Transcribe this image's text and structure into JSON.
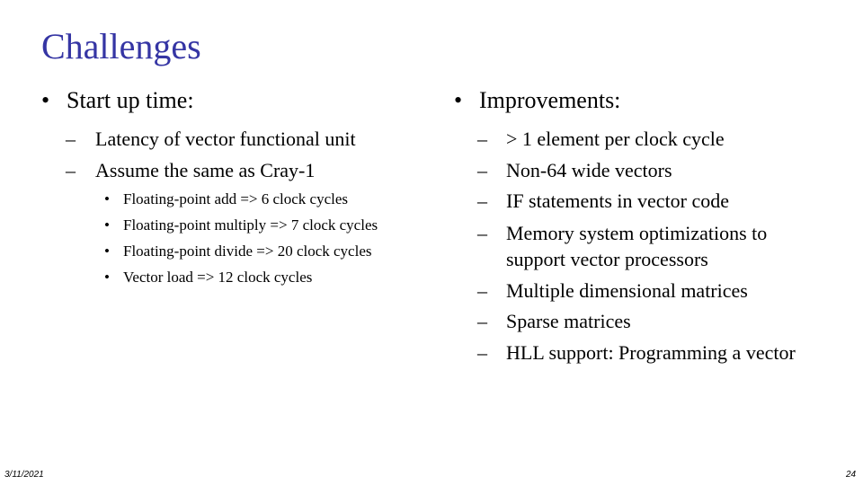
{
  "slide": {
    "title": "Challenges",
    "title_color": "#3535a4",
    "left_column": {
      "heading": "Start up time:",
      "items": [
        {
          "text": "Latency of vector functional unit",
          "subitems": []
        },
        {
          "text": "Assume the same as Cray-1",
          "subitems": [
            "Floating-point add => 6 clock cycles",
            "Floating-point multiply => 7 clock cycles",
            "Floating-point divide => 20 clock cycles",
            "Vector load => 12 clock cycles"
          ]
        }
      ]
    },
    "right_column": {
      "heading": "Improvements:",
      "items": [
        "> 1 element per clock cycle",
        "Non-64 wide vectors",
        "IF statements in vector code",
        "Memory system optimizations to support vector processors",
        "Multiple dimensional matrices",
        "Sparse matrices",
        "HLL support: Programming a vector"
      ]
    },
    "markers": {
      "bullet": "•",
      "dash": "–"
    },
    "footer": {
      "date": "3/11/2021",
      "page_number": "24"
    }
  }
}
